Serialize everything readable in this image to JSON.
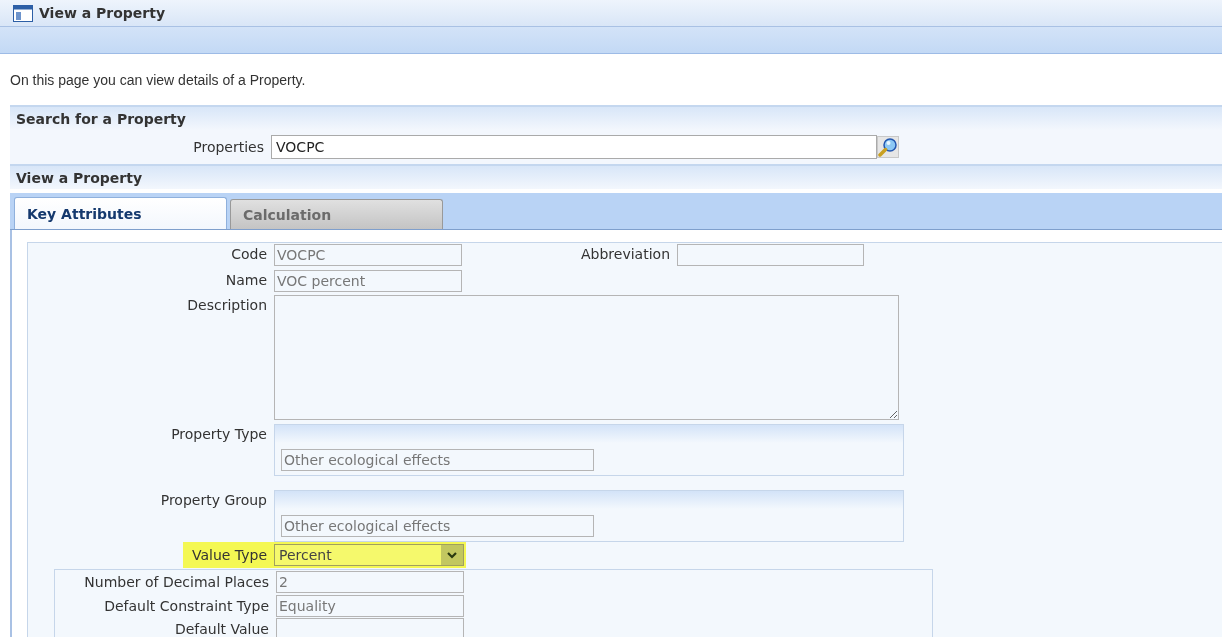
{
  "window": {
    "title": "View a Property"
  },
  "intro": "On this page you can view details of a Property.",
  "search_section": {
    "title": "Search for a Property",
    "label": "Properties",
    "value": "VOCPC"
  },
  "view_section": {
    "title": "View a Property"
  },
  "tabs": [
    {
      "label": "Key Attributes",
      "selected": true
    },
    {
      "label": "Calculation",
      "selected": false
    }
  ],
  "form": {
    "code": {
      "label": "Code",
      "value": "VOCPC"
    },
    "abbreviation": {
      "label": "Abbreviation"
    },
    "name": {
      "label": "Name",
      "value": "VOC percent"
    },
    "description": {
      "label": "Description"
    },
    "property_type": {
      "label": "Property Type",
      "value": "Other ecological effects"
    },
    "property_group": {
      "label": "Property Group",
      "value": "Other ecological effects"
    },
    "value_type": {
      "label": "Value Type",
      "value": "Percent",
      "highlighted": true
    },
    "details": [
      {
        "label": "Number of Decimal Places",
        "value": "2"
      },
      {
        "label": "Default Constraint Type",
        "value": "Equality"
      },
      {
        "label": "Default Value"
      }
    ]
  }
}
